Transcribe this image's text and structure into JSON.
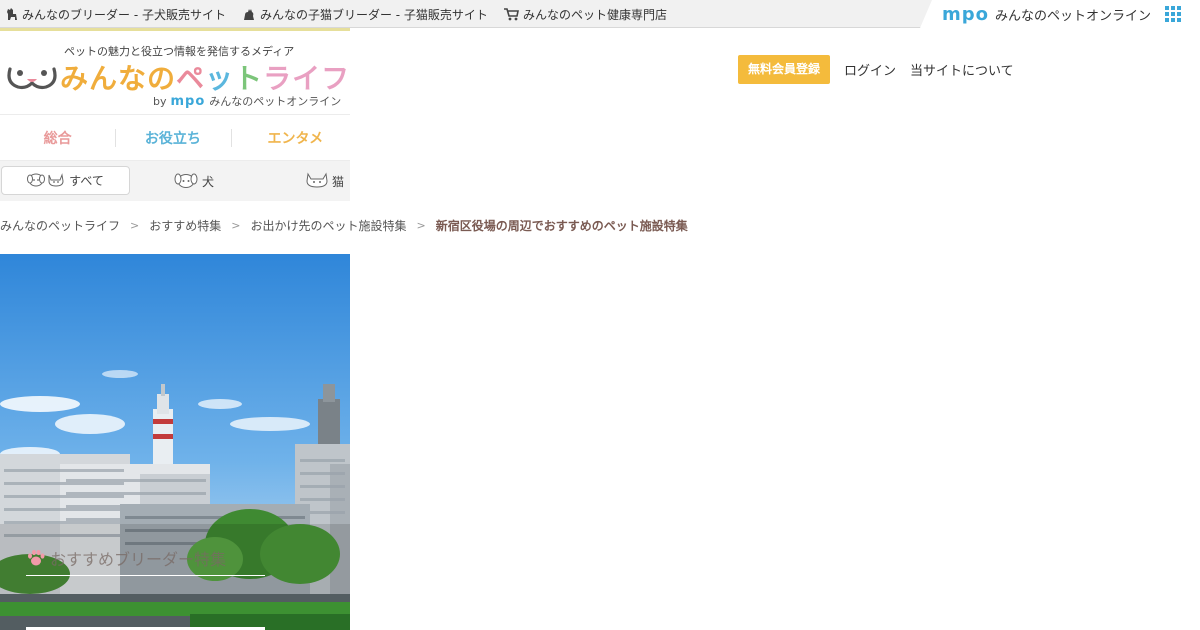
{
  "topbar": {
    "links": [
      {
        "label": "みんなのブリーダー - 子犬販売サイト",
        "icon": "dog-icon"
      },
      {
        "label": "みんなの子猫ブリーダー - 子猫販売サイト",
        "icon": "cat-icon"
      },
      {
        "label": "みんなのペット健康専門店",
        "icon": "cart-icon"
      }
    ],
    "brand": {
      "logo": "mpo",
      "name": "みんなのペットオンライン",
      "menu_icon": "grid-menu-icon"
    }
  },
  "site": {
    "tagline": "ペットの魅力と役立つ情報を発信するメディア",
    "logo_text": [
      "みんなの",
      "ペ",
      "ッ",
      "ト",
      "ライフ"
    ],
    "by_prefix": "by",
    "by_logo": "mpo",
    "by_name": "みんなのペットオンライン"
  },
  "header_nav": {
    "register": "無料会員登録",
    "login": "ログイン",
    "about": "当サイトについて"
  },
  "category_nav": {
    "tabs": [
      {
        "label": "総合",
        "color": "#e99a9a"
      },
      {
        "label": "お役立ち",
        "color": "#5ab3d8"
      },
      {
        "label": "エンタメ",
        "color": "#f0b54d"
      }
    ]
  },
  "pet_filter": {
    "items": [
      {
        "label": "すべて",
        "icon": "dog-cat-icon",
        "active": true
      },
      {
        "label": "犬",
        "icon": "dog-face-icon",
        "active": false
      },
      {
        "label": "猫",
        "icon": "cat-face-icon",
        "active": false
      }
    ]
  },
  "breadcrumb": {
    "items": [
      "みんなのペットライフ",
      "おすすめ特集",
      "お出かけ先のペット施設特集"
    ],
    "current": "新宿区役場の周辺でおすすめのペット施設特集",
    "separator": ">"
  },
  "hero": {
    "label": "おすすめブリーダー特集",
    "icon": "paw-icon"
  },
  "colors": {
    "accent_blue": "#3aa7d9",
    "register_bg": "#f4bb3c",
    "breadcrumb_current": "#7a5a52"
  }
}
